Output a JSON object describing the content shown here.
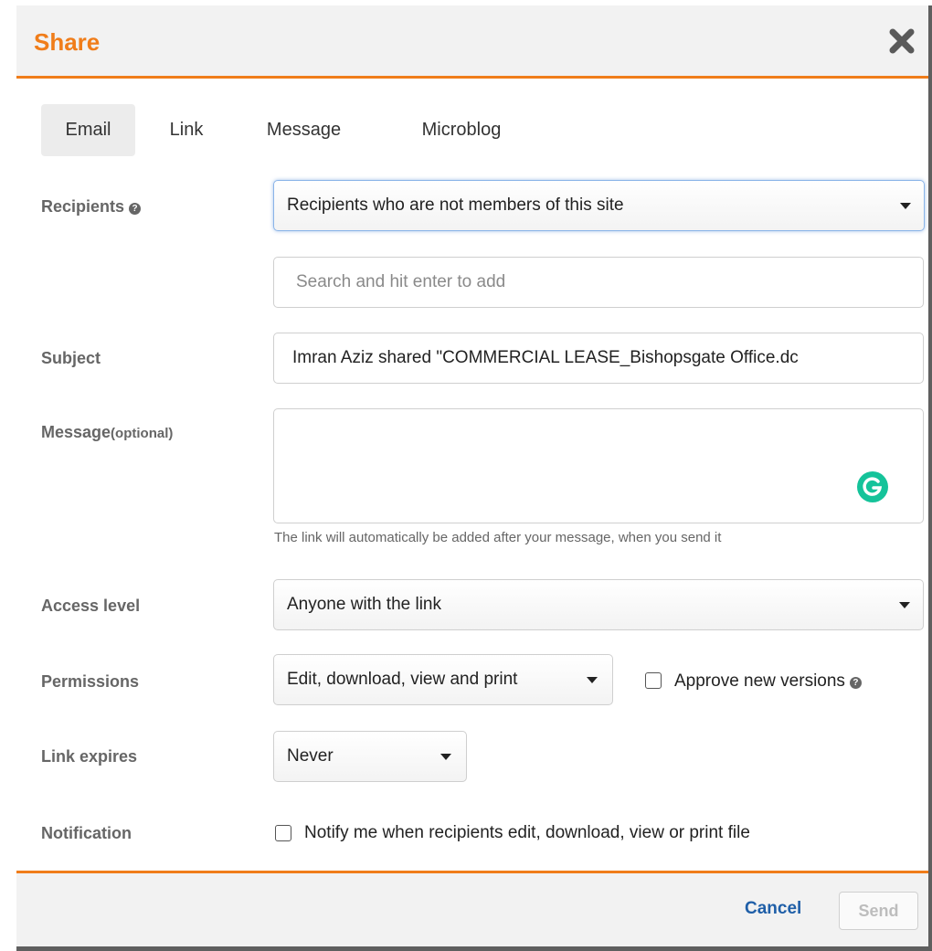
{
  "dialog": {
    "title": "Share",
    "accent_color": "#f07d1a"
  },
  "tabs": [
    {
      "label": "Email",
      "active": true
    },
    {
      "label": "Link",
      "active": false
    },
    {
      "label": "Message",
      "active": false
    },
    {
      "label": "Microblog",
      "active": false
    }
  ],
  "form": {
    "recipients": {
      "label": "Recipients",
      "selected": "Recipients who are not members of this site",
      "search_placeholder": "Search and hit enter to add"
    },
    "subject": {
      "label": "Subject",
      "value": "Imran Aziz shared \"COMMERCIAL LEASE_Bishopsgate Office.dc"
    },
    "message": {
      "label": "Message",
      "label_suffix": "(optional)",
      "value": "",
      "hint": "The link will automatically be added after your message, when you send it"
    },
    "access_level": {
      "label": "Access level",
      "selected": "Anyone with the link"
    },
    "permissions": {
      "label": "Permissions",
      "selected": "Edit, download, view and print",
      "approve_label": "Approve new versions",
      "approve_checked": false
    },
    "link_expires": {
      "label": "Link expires",
      "selected": "Never"
    },
    "notification": {
      "label": "Notification",
      "checkbox_label": "Notify me when recipients edit, download, view or print file",
      "checked": false
    }
  },
  "footer": {
    "cancel_label": "Cancel",
    "send_label": "Send"
  },
  "icons": {
    "close": "close-icon",
    "help": "help-icon",
    "grammarly": "grammarly-icon",
    "dropdown": "chevron-down-icon"
  }
}
